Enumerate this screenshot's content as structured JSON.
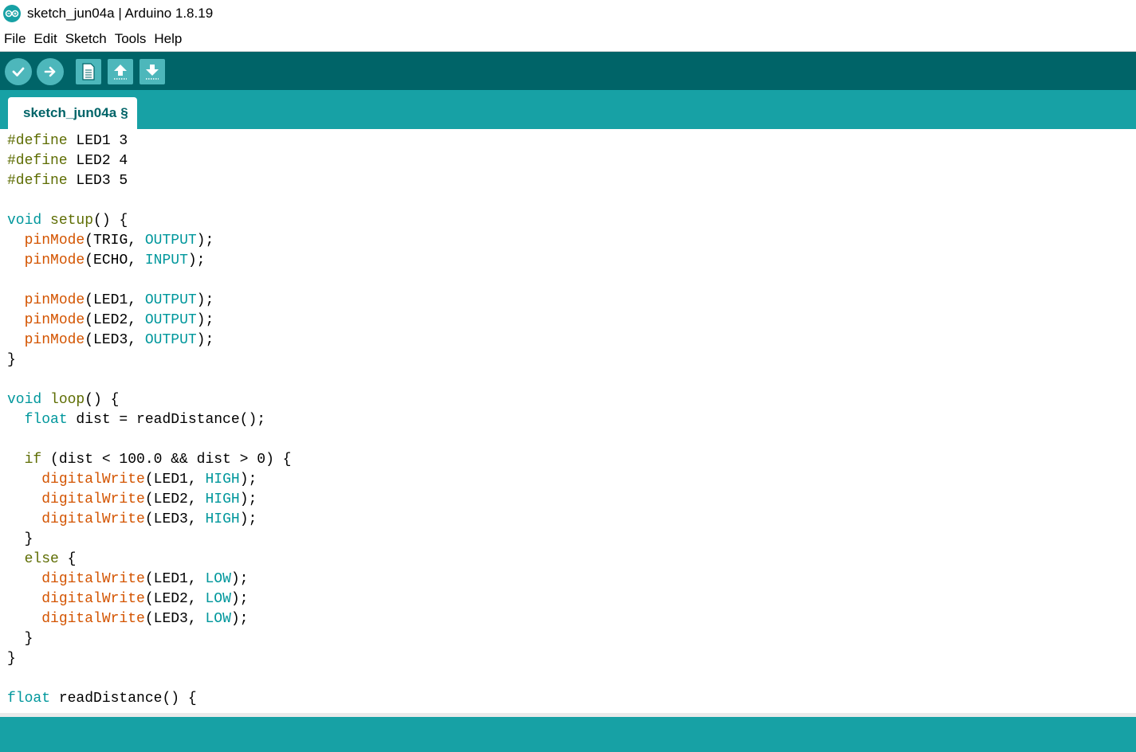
{
  "window": {
    "title": "sketch_jun04a | Arduino 1.8.19",
    "icon": "arduino-infinity-icon"
  },
  "menu": {
    "items": [
      "File",
      "Edit",
      "Sketch",
      "Tools",
      "Help"
    ]
  },
  "toolbar": {
    "buttons": [
      {
        "name": "verify",
        "icon": "check-icon"
      },
      {
        "name": "upload",
        "icon": "arrow-right-icon"
      },
      {
        "name": "new",
        "icon": "new-file-icon"
      },
      {
        "name": "open",
        "icon": "arrow-up-icon"
      },
      {
        "name": "save",
        "icon": "arrow-down-icon"
      }
    ]
  },
  "tabs": [
    {
      "label": "sketch_jun04a",
      "modified_mark": "§"
    }
  ],
  "code": [
    [
      {
        "t": "#define",
        "c": "pre"
      },
      {
        "t": " LED1 3"
      }
    ],
    [
      {
        "t": "#define",
        "c": "pre"
      },
      {
        "t": " LED2 4"
      }
    ],
    [
      {
        "t": "#define",
        "c": "pre"
      },
      {
        "t": " LED3 5"
      }
    ],
    [],
    [
      {
        "t": "void",
        "c": "type"
      },
      {
        "t": " "
      },
      {
        "t": "setup",
        "c": "ctrl"
      },
      {
        "t": "() {"
      }
    ],
    [
      {
        "t": "  "
      },
      {
        "t": "pinMode",
        "c": "func"
      },
      {
        "t": "(TRIG, "
      },
      {
        "t": "OUTPUT",
        "c": "const"
      },
      {
        "t": ");"
      }
    ],
    [
      {
        "t": "  "
      },
      {
        "t": "pinMode",
        "c": "func"
      },
      {
        "t": "(ECHO, "
      },
      {
        "t": "INPUT",
        "c": "const"
      },
      {
        "t": ");"
      }
    ],
    [],
    [
      {
        "t": "  "
      },
      {
        "t": "pinMode",
        "c": "func"
      },
      {
        "t": "(LED1, "
      },
      {
        "t": "OUTPUT",
        "c": "const"
      },
      {
        "t": ");"
      }
    ],
    [
      {
        "t": "  "
      },
      {
        "t": "pinMode",
        "c": "func"
      },
      {
        "t": "(LED2, "
      },
      {
        "t": "OUTPUT",
        "c": "const"
      },
      {
        "t": ");"
      }
    ],
    [
      {
        "t": "  "
      },
      {
        "t": "pinMode",
        "c": "func"
      },
      {
        "t": "(LED3, "
      },
      {
        "t": "OUTPUT",
        "c": "const"
      },
      {
        "t": ");"
      }
    ],
    [
      {
        "t": "}"
      }
    ],
    [],
    [
      {
        "t": "void",
        "c": "type"
      },
      {
        "t": " "
      },
      {
        "t": "loop",
        "c": "ctrl"
      },
      {
        "t": "() {"
      }
    ],
    [
      {
        "t": "  "
      },
      {
        "t": "float",
        "c": "type"
      },
      {
        "t": " dist = readDistance();"
      }
    ],
    [],
    [
      {
        "t": "  "
      },
      {
        "t": "if",
        "c": "ctrl"
      },
      {
        "t": " (dist < 100.0 && dist > 0) {"
      }
    ],
    [
      {
        "t": "    "
      },
      {
        "t": "digitalWrite",
        "c": "func"
      },
      {
        "t": "(LED1, "
      },
      {
        "t": "HIGH",
        "c": "const"
      },
      {
        "t": ");"
      }
    ],
    [
      {
        "t": "    "
      },
      {
        "t": "digitalWrite",
        "c": "func"
      },
      {
        "t": "(LED2, "
      },
      {
        "t": "HIGH",
        "c": "const"
      },
      {
        "t": ");"
      }
    ],
    [
      {
        "t": "    "
      },
      {
        "t": "digitalWrite",
        "c": "func"
      },
      {
        "t": "(LED3, "
      },
      {
        "t": "HIGH",
        "c": "const"
      },
      {
        "t": ");"
      }
    ],
    [
      {
        "t": "  }"
      }
    ],
    [
      {
        "t": "  "
      },
      {
        "t": "else",
        "c": "ctrl"
      },
      {
        "t": " {"
      }
    ],
    [
      {
        "t": "    "
      },
      {
        "t": "digitalWrite",
        "c": "func"
      },
      {
        "t": "(LED1, "
      },
      {
        "t": "LOW",
        "c": "const"
      },
      {
        "t": ");"
      }
    ],
    [
      {
        "t": "    "
      },
      {
        "t": "digitalWrite",
        "c": "func"
      },
      {
        "t": "(LED2, "
      },
      {
        "t": "LOW",
        "c": "const"
      },
      {
        "t": ");"
      }
    ],
    [
      {
        "t": "    "
      },
      {
        "t": "digitalWrite",
        "c": "func"
      },
      {
        "t": "(LED3, "
      },
      {
        "t": "LOW",
        "c": "const"
      },
      {
        "t": ");"
      }
    ],
    [
      {
        "t": "  }"
      }
    ],
    [
      {
        "t": "}"
      }
    ],
    [],
    [
      {
        "t": "float",
        "c": "type"
      },
      {
        "t": " readDistance() {"
      }
    ]
  ],
  "colors": {
    "toolbar_bg": "#006468",
    "tabbar_bg": "#17a1a5",
    "button_bg": "#4db7bb",
    "preprocessor": "#5e6d03",
    "type_keyword": "#00979c",
    "function": "#d35400",
    "constant": "#00979c"
  }
}
